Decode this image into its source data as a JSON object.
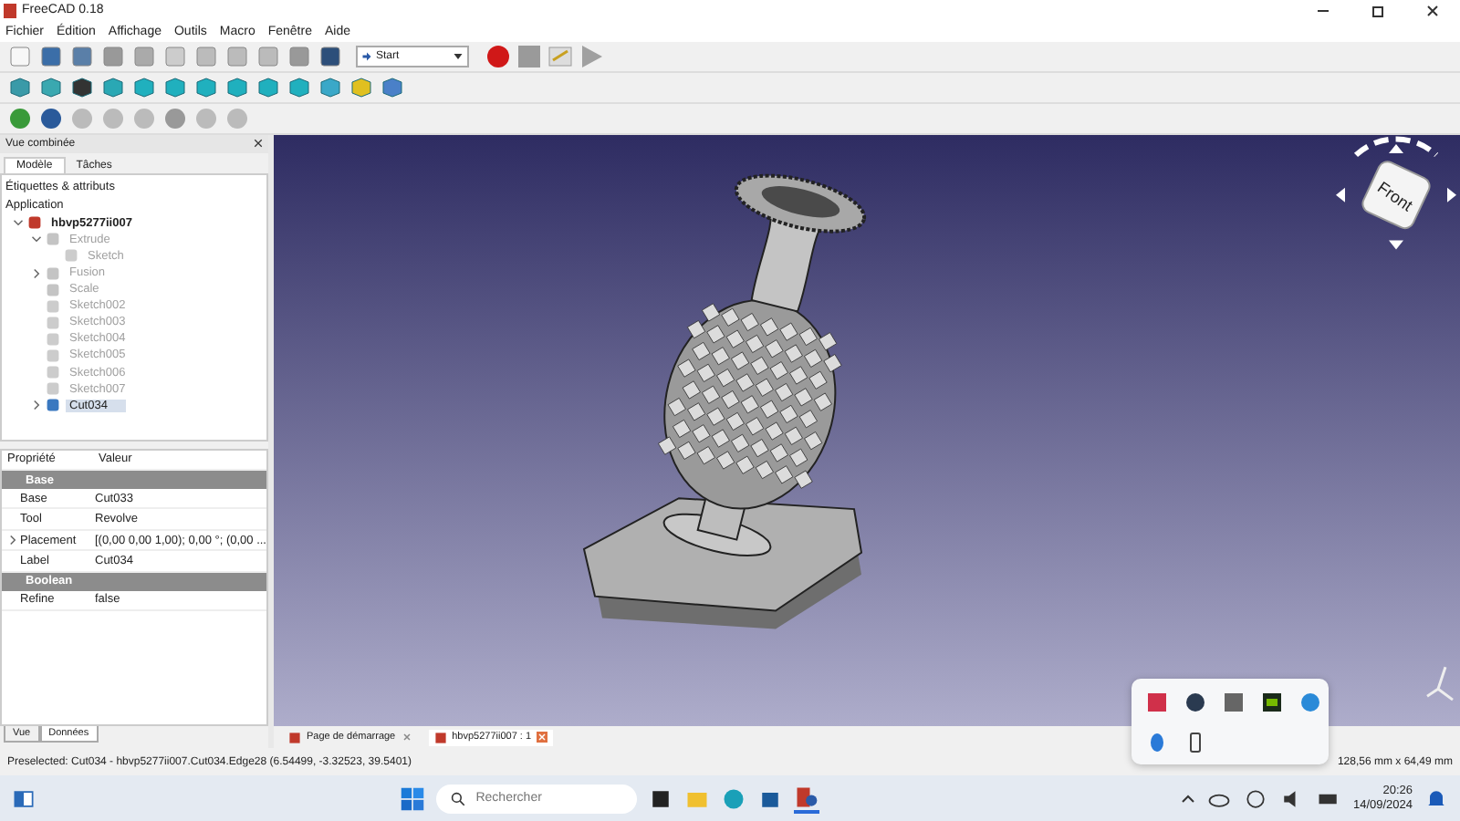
{
  "window": {
    "title": "FreeCAD 0.18"
  },
  "menu": [
    "Fichier",
    "Édition",
    "Affichage",
    "Outils",
    "Macro",
    "Fenêtre",
    "Aide"
  ],
  "workbench": {
    "value": "Start"
  },
  "combo_view": {
    "title": "Vue combinée",
    "tabs": [
      {
        "label": "Modèle",
        "selected": true
      },
      {
        "label": "Tâches",
        "selected": false
      }
    ],
    "tree": {
      "heading": "Étiquettes & attributs",
      "root": "Application",
      "items": [
        {
          "label": "hbvp5277ii007",
          "kind": "document",
          "visible": true,
          "selected": false,
          "expanded": true,
          "children": [
            {
              "label": "Extrude",
              "kind": "extrude",
              "visible": false,
              "selected": false,
              "expanded": true,
              "children": [
                {
                  "label": "Sketch",
                  "kind": "sketch",
                  "visible": false,
                  "selected": false
                }
              ]
            },
            {
              "label": "Fusion",
              "kind": "fusion",
              "visible": false,
              "selected": false,
              "expanded": false
            },
            {
              "label": "Scale",
              "kind": "scale",
              "visible": false,
              "selected": false
            },
            {
              "label": "Sketch002",
              "kind": "sketch",
              "visible": false,
              "selected": false
            },
            {
              "label": "Sketch003",
              "kind": "sketch",
              "visible": false,
              "selected": false
            },
            {
              "label": "Sketch004",
              "kind": "sketch",
              "visible": false,
              "selected": false
            },
            {
              "label": "Sketch005",
              "kind": "sketch",
              "visible": false,
              "selected": false
            },
            {
              "label": "Sketch006",
              "kind": "sketch",
              "visible": false,
              "selected": false
            },
            {
              "label": "Sketch007",
              "kind": "sketch",
              "visible": false,
              "selected": false
            },
            {
              "label": "Cut034",
              "kind": "solid",
              "visible": true,
              "selected": true,
              "expanded": false
            }
          ]
        }
      ]
    },
    "properties": {
      "columns": [
        "Propriété",
        "Valeur"
      ],
      "groups": [
        {
          "name": "Base",
          "rows": [
            {
              "name": "Base",
              "value": "Cut033"
            },
            {
              "name": "Tool",
              "value": "Revolve"
            },
            {
              "name": "Placement",
              "value": "[(0,00 0,00 1,00); 0,00 °; (0,00 ...",
              "expanded": false
            },
            {
              "name": "Label",
              "value": "Cut034"
            }
          ]
        },
        {
          "name": "Boolean",
          "rows": [
            {
              "name": "Refine",
              "value": "false"
            }
          ]
        }
      ]
    },
    "bottom_tabs": [
      {
        "label": "Vue",
        "selected": false
      },
      {
        "label": "Données",
        "selected": true
      }
    ]
  },
  "viewport": {
    "nav_cube": {
      "face": "Front"
    }
  },
  "document_tabs": [
    {
      "label": "Page de démarrage",
      "selected": false
    },
    {
      "label": "hbvp5277ii007 : 1",
      "selected": true
    }
  ],
  "status_bar": {
    "message": "Preselected: Cut034 - hbvp5277ii007.Cut034.Edge28 (6.54499, -3.32523, 39.5401)",
    "dimensions": "128,56 mm x 64,49 mm"
  },
  "taskbar": {
    "search": {
      "placeholder": "Rechercher"
    },
    "time": "20:26",
    "date": "14/09/2024"
  }
}
